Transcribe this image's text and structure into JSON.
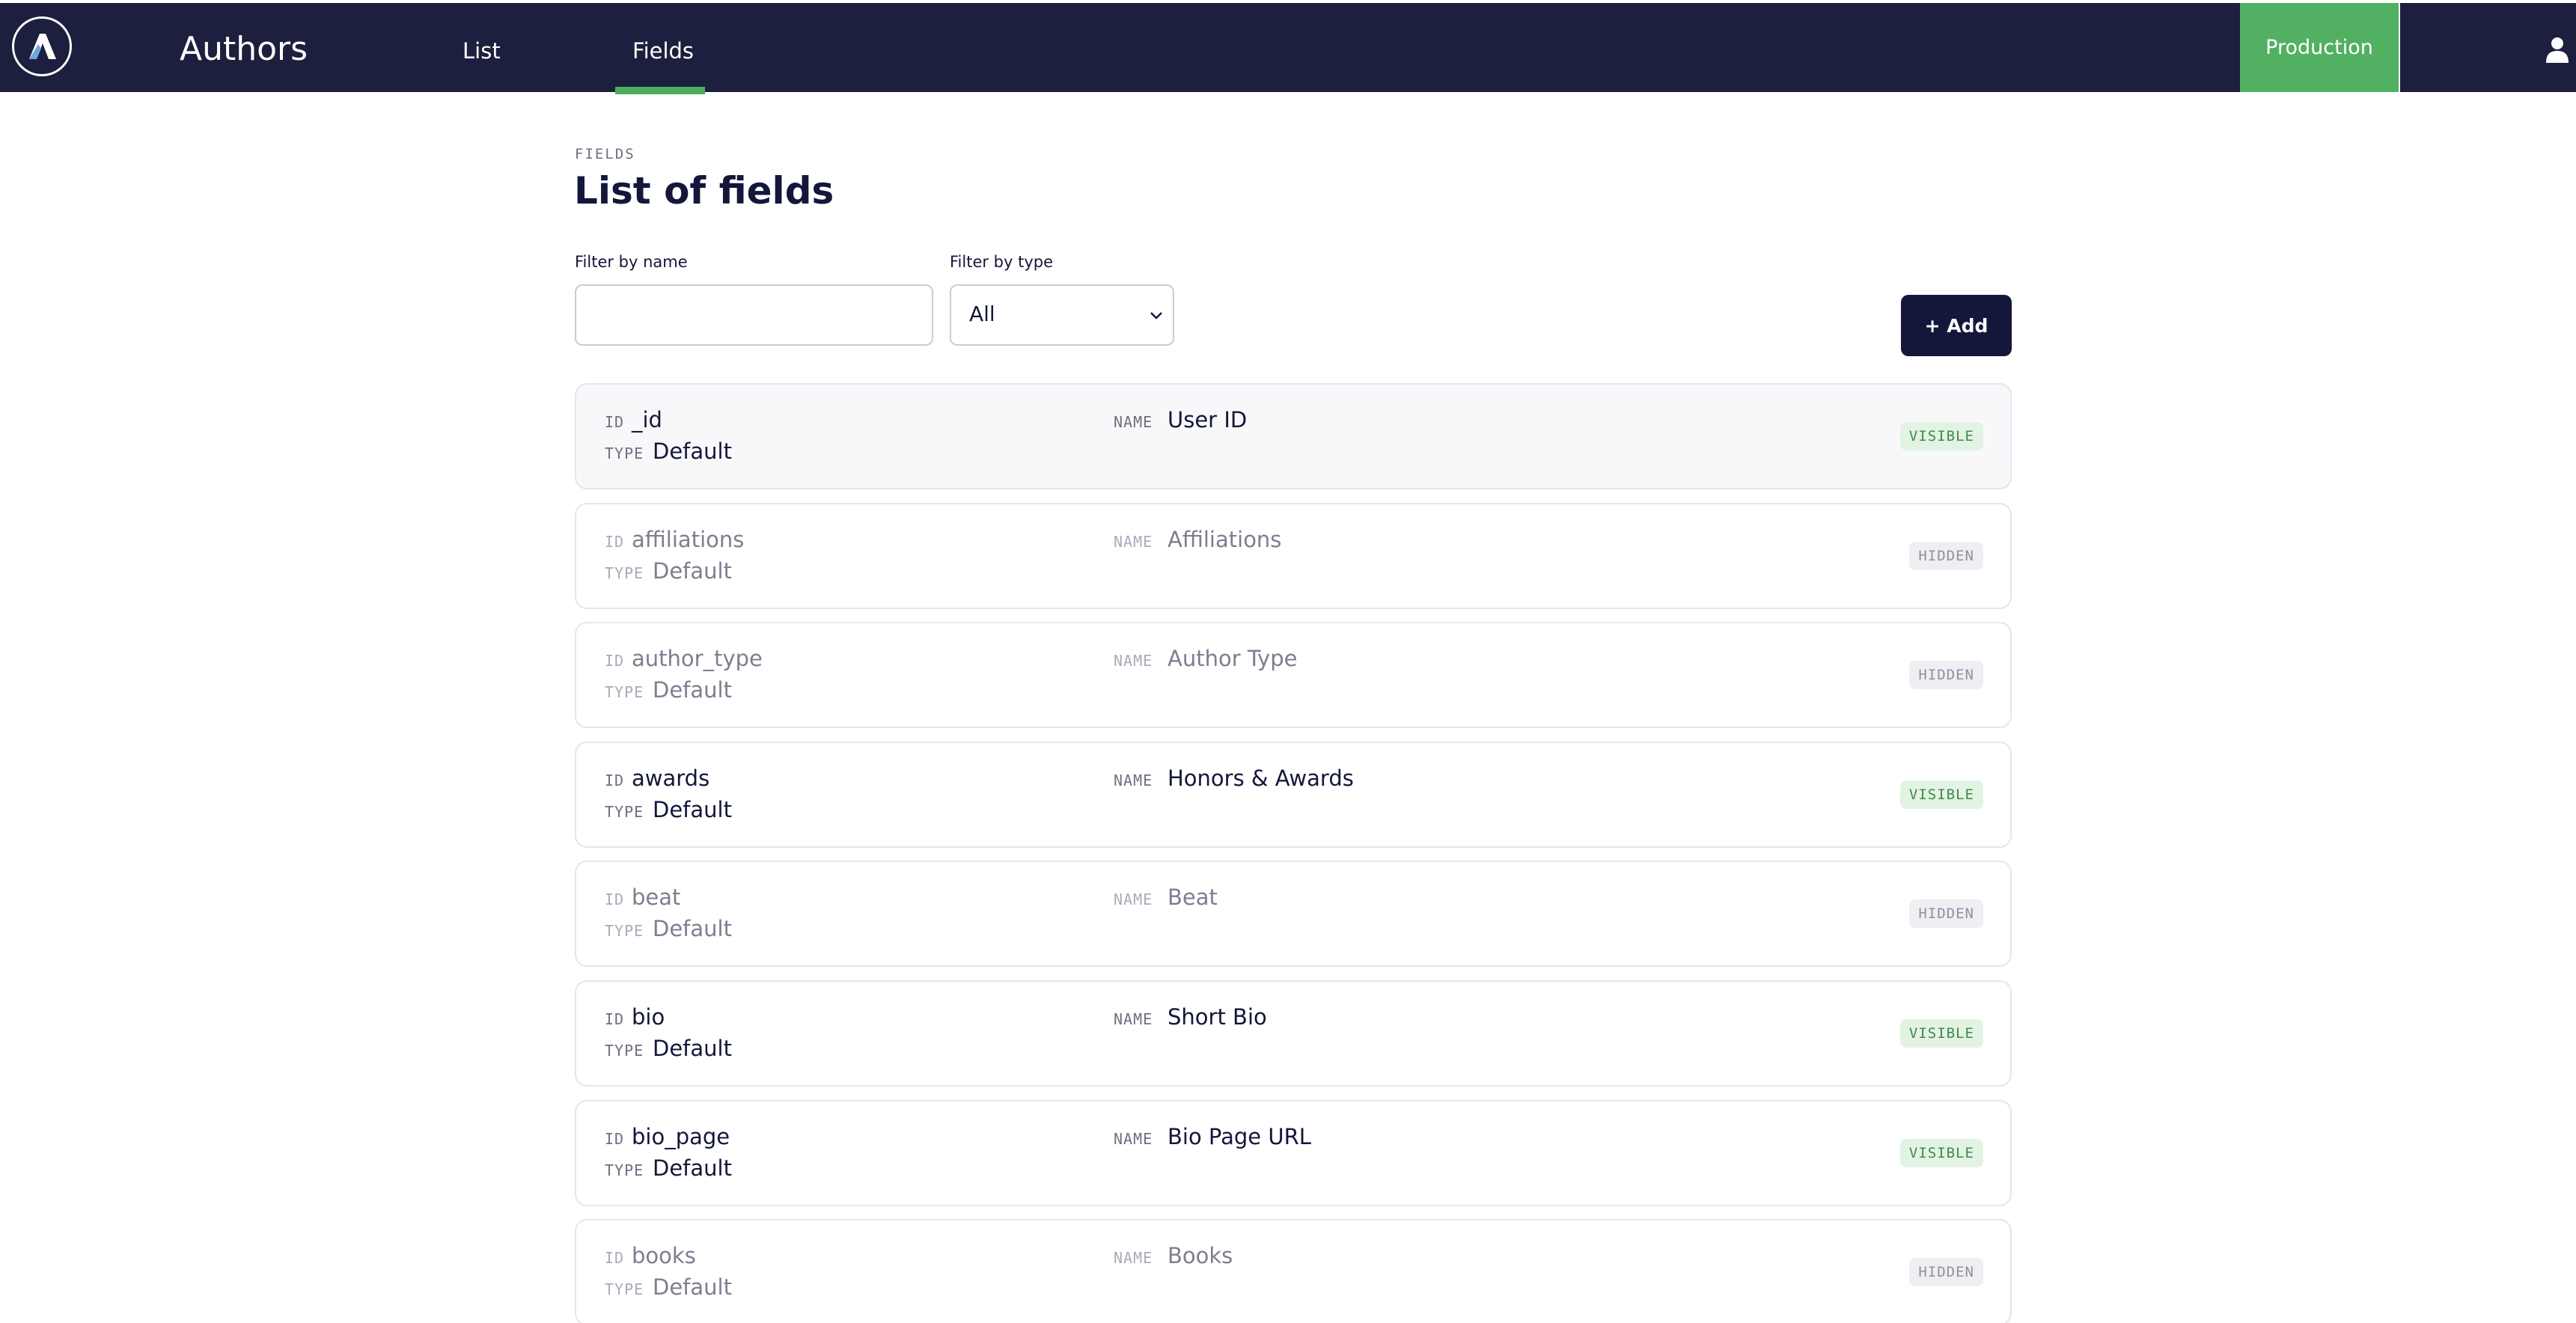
{
  "header": {
    "app_title": "Authors",
    "tabs": [
      {
        "label": "List",
        "active": false
      },
      {
        "label": "Fields",
        "active": true
      }
    ],
    "environment_button": "Production",
    "colors": {
      "nav_bg": "#1c1f3d",
      "accent_green": "#52b063"
    }
  },
  "page": {
    "section_label": "FIELDS",
    "title": "List of fields"
  },
  "filters": {
    "name_label": "Filter by name",
    "name_value": "",
    "type_label": "Filter by type",
    "type_value": "All",
    "add_button": "+ Add"
  },
  "labels": {
    "id": "ID",
    "type": "TYPE",
    "name": "NAME"
  },
  "fields": [
    {
      "id": "_id",
      "type": "Default",
      "name": "User ID",
      "status": "VISIBLE"
    },
    {
      "id": "affiliations",
      "type": "Default",
      "name": "Affiliations",
      "status": "HIDDEN"
    },
    {
      "id": "author_type",
      "type": "Default",
      "name": "Author Type",
      "status": "HIDDEN"
    },
    {
      "id": "awards",
      "type": "Default",
      "name": "Honors & Awards",
      "status": "VISIBLE"
    },
    {
      "id": "beat",
      "type": "Default",
      "name": "Beat",
      "status": "HIDDEN"
    },
    {
      "id": "bio",
      "type": "Default",
      "name": "Short Bio",
      "status": "VISIBLE"
    },
    {
      "id": "bio_page",
      "type": "Default",
      "name": "Bio Page URL",
      "status": "VISIBLE"
    },
    {
      "id": "books",
      "type": "Default",
      "name": "Books",
      "status": "HIDDEN"
    }
  ]
}
